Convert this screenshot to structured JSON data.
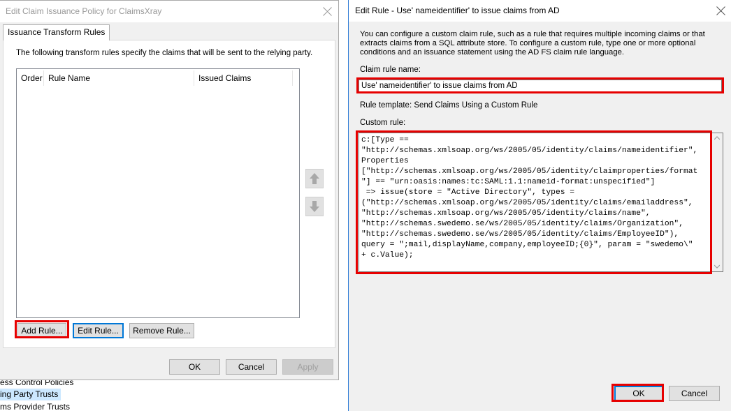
{
  "background_tree": {
    "items": [
      {
        "label": "ess Control Policies",
        "selected": false
      },
      {
        "label": "ing Party Trusts",
        "selected": true
      },
      {
        "label": "ms Provider Trusts",
        "selected": false
      }
    ]
  },
  "left_dialog": {
    "title": "Edit Claim Issuance Policy for ClaimsXray",
    "tab_label": "Issuance Transform Rules",
    "description": "The following transform rules specify the claims that will be sent to the relying party.",
    "columns": [
      "Order",
      "Rule Name",
      "Issued Claims"
    ],
    "rows": [],
    "buttons": {
      "add_rule": "Add Rule...",
      "edit_rule": "Edit Rule...",
      "remove_rule": "Remove Rule...",
      "ok": "OK",
      "cancel": "Cancel",
      "apply": "Apply"
    },
    "icons": {
      "move_up": "arrow-up-icon",
      "move_down": "arrow-down-icon",
      "close": "close-icon"
    }
  },
  "right_dialog": {
    "title": "Edit Rule - Use' nameidentifier' to issue claims from AD",
    "description": "You can configure a custom claim rule, such as a rule that requires multiple incoming claims or that extracts claims from a SQL attribute store. To configure a custom rule, type one or more optional conditions and an issuance statement using the AD FS claim rule language.",
    "claim_rule_name_label": "Claim rule name:",
    "claim_rule_name_value": "Use' nameidentifier' to issue claims from AD",
    "rule_template": "Rule template: Send Claims Using a Custom Rule",
    "custom_rule_label": "Custom rule:",
    "custom_rule_lines": [
      "c:[Type ==",
      "\"http://schemas.xmlsoap.org/ws/2005/05/identity/claims/nameidentifier\",",
      "Properties",
      "[\"http://schemas.xmlsoap.org/ws/2005/05/identity/claimproperties/format",
      "\"] == \"urn:oasis:names:tc:SAML:1.1:nameid-format:unspecified\"]",
      " => issue(store = \"Active Directory\", types =",
      "(\"http://schemas.xmlsoap.org/ws/2005/05/identity/claims/emailaddress\",",
      "\"http://schemas.xmlsoap.org/ws/2005/05/identity/claims/name\",",
      "\"http://schemas.swedemo.se/ws/2005/05/identity/claims/Organization\",",
      "\"http://schemas.swedemo.se/ws/2005/05/identity/claims/EmployeeID\"),",
      "query = \";mail,displayName,company,employeeID;{0}\", param = \"swedemo\\\"",
      "+ c.Value);"
    ],
    "buttons": {
      "ok": "OK",
      "cancel": "Cancel"
    }
  },
  "colors": {
    "highlight": "#e60000",
    "focus": "#0078d7",
    "dialog_bg": "#f0f0f0"
  }
}
